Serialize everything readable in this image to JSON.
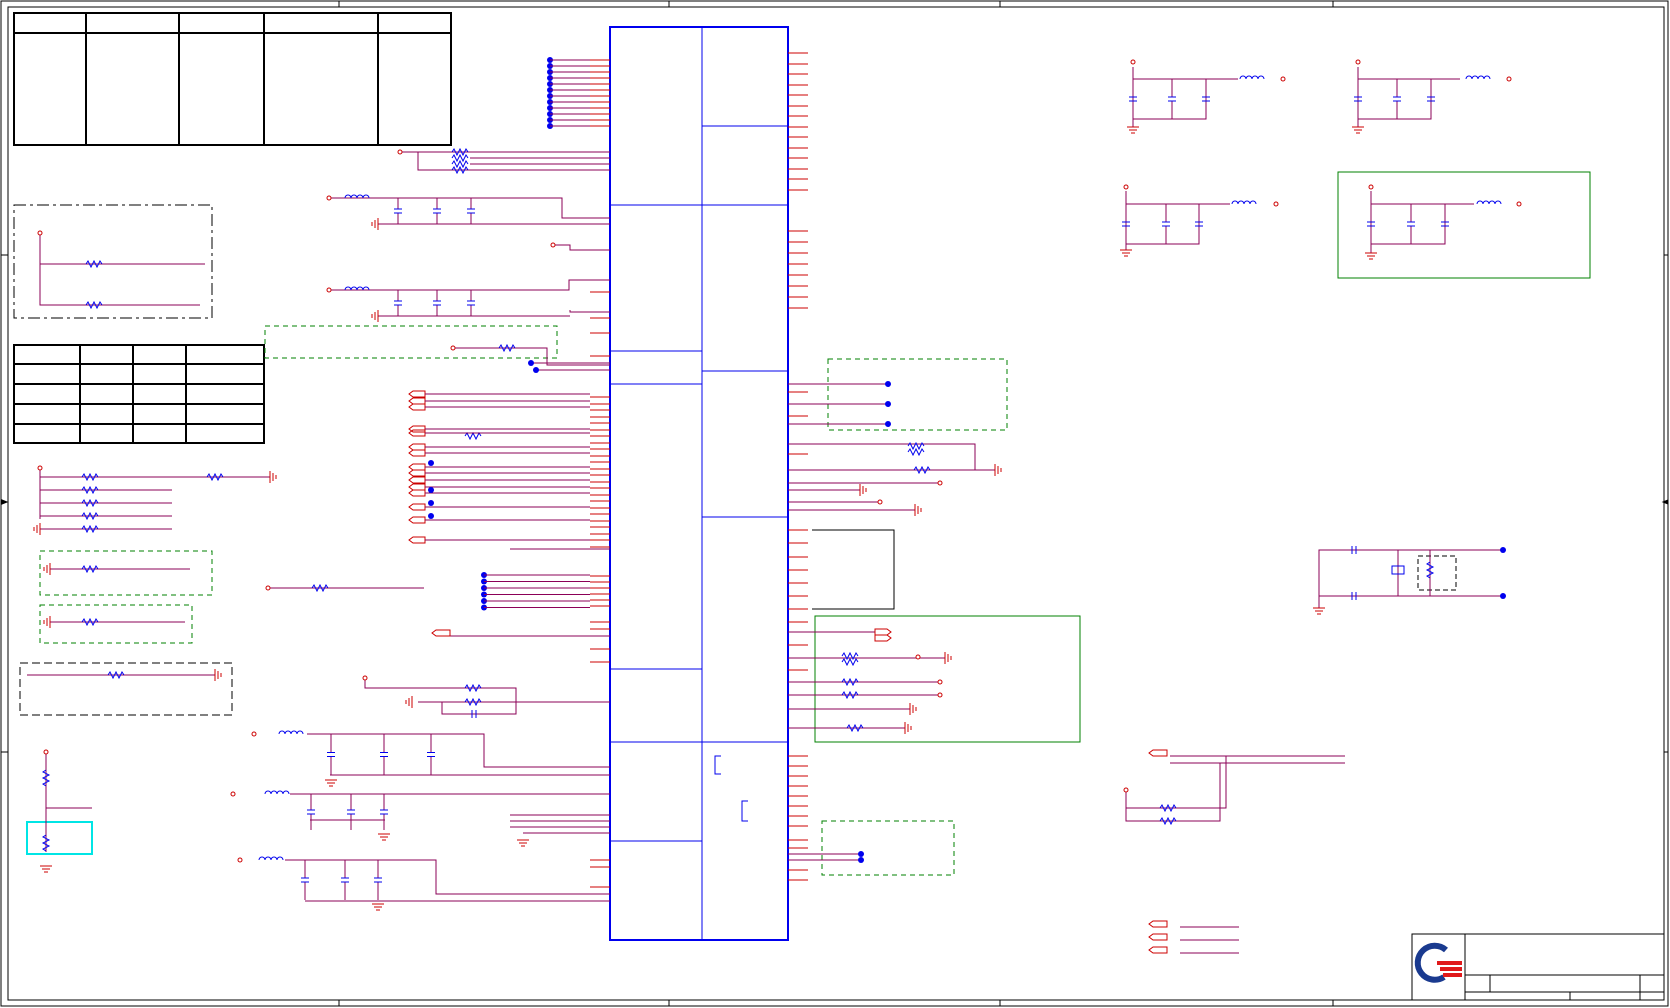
{
  "document": {
    "kind": "schematic-sheet",
    "border_zone_marks": true
  },
  "colors": {
    "border": "#000000",
    "wire": "#8b0057",
    "pin": "#cc0000",
    "part": "#0000ee",
    "junction": "#0000ee",
    "power": "#cc0000",
    "group_box_green": "#008000",
    "group_box_black": "#000000",
    "highlight_cyan": "#00e5e5",
    "logo_blue": "#1a3a8f",
    "logo_red": "#e0191b"
  },
  "tables": {
    "top_left_columns": 5,
    "mid_left_rows": 5,
    "mid_left_columns": 4
  },
  "ic": {
    "name": "main-ic-symbol",
    "left_pin_count": 86,
    "right_pin_count": 70
  },
  "title_block": {
    "logo": "company-logo"
  }
}
